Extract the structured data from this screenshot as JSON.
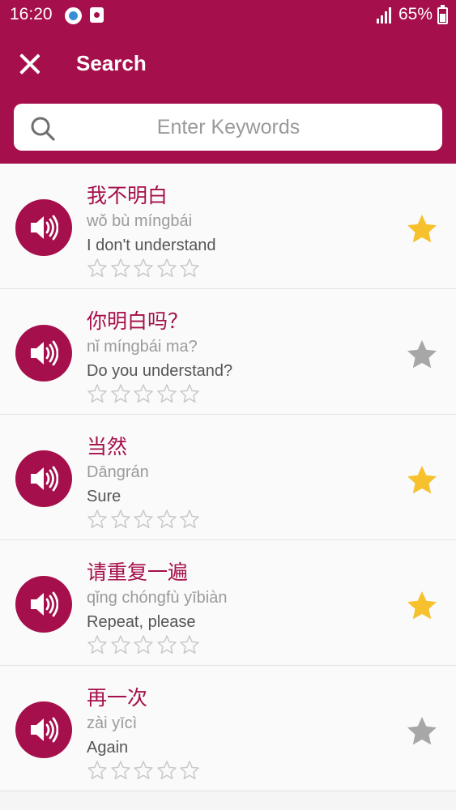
{
  "status_bar": {
    "time": "16:20",
    "battery": "65%"
  },
  "header": {
    "title": "Search"
  },
  "search": {
    "placeholder": "Enter Keywords",
    "value": ""
  },
  "colors": {
    "brand": "#a50f4b",
    "star_active": "#f6c12d",
    "star_inactive": "#a7a7a7"
  },
  "phrases": [
    {
      "chinese": "我不明白",
      "pinyin": "wǒ bù míngbái",
      "english": "I don't understand",
      "favorite": true,
      "rating": 0
    },
    {
      "chinese": "你明白吗？",
      "pinyin": "nǐ míngbái ma?",
      "english": "Do you understand?",
      "favorite": false,
      "rating": 0
    },
    {
      "chinese": "当然",
      "pinyin": "Dāngrán",
      "english": "Sure",
      "favorite": true,
      "rating": 0
    },
    {
      "chinese": "请重复一遍",
      "pinyin": "qǐng chóngfù yībiàn",
      "english": "Repeat, please",
      "favorite": true,
      "rating": 0
    },
    {
      "chinese": "再一次",
      "pinyin": "zài yīcì",
      "english": "Again",
      "favorite": false,
      "rating": 0
    }
  ]
}
